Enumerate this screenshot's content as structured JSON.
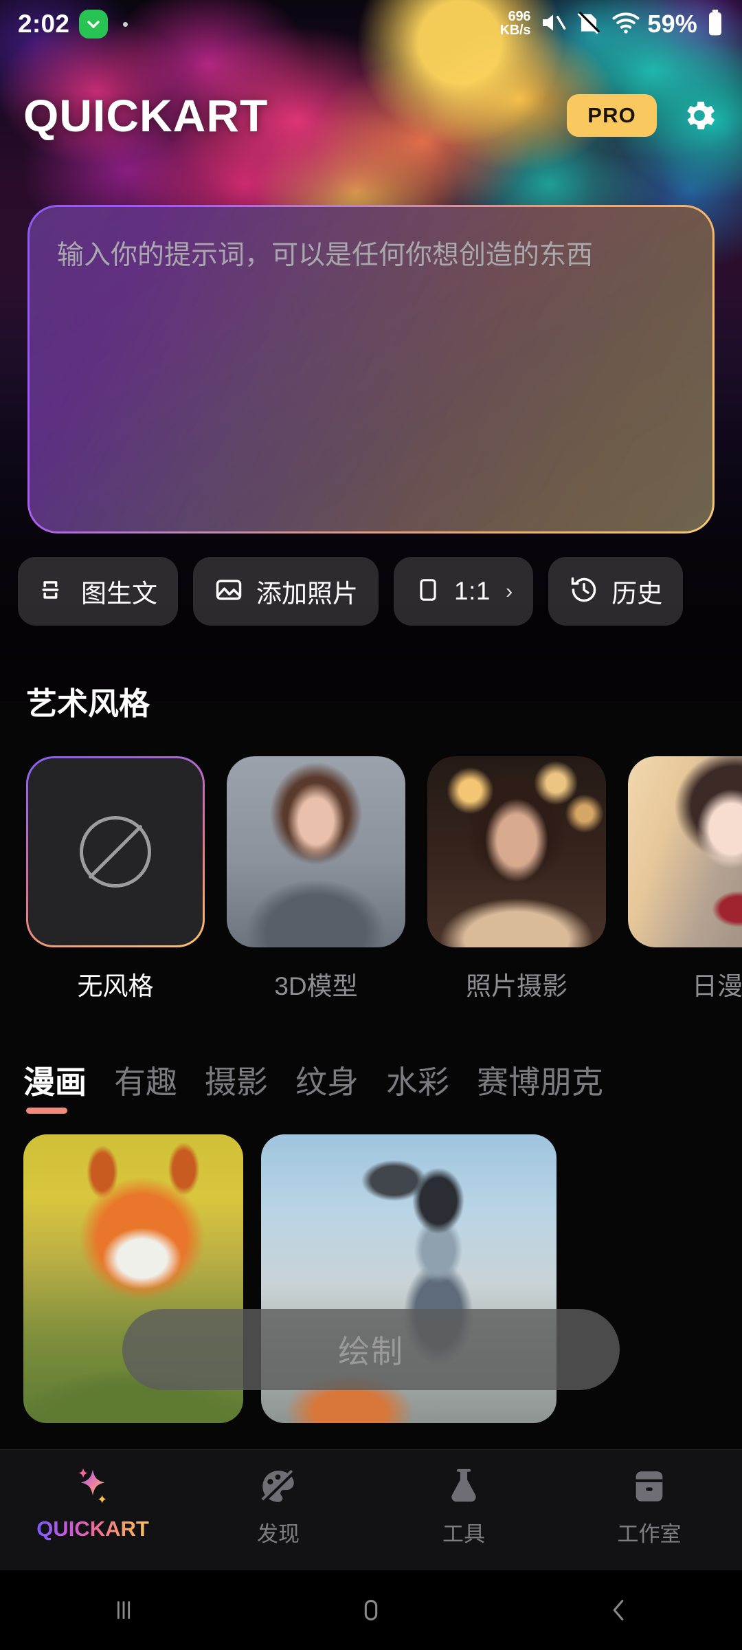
{
  "statusbar": {
    "time": "2:02",
    "badge_icon": "download-chevron-icon",
    "net_speed_value": "696",
    "net_speed_unit": "KB/s",
    "mute_icon": "volume-mute-icon",
    "nosim_icon": "no-sim-icon",
    "wifi_icon": "wifi-icon",
    "battery_percent": "59%",
    "battery_icon": "battery-icon"
  },
  "header": {
    "brand": "QUICKART",
    "pro_label": "PRO",
    "settings_icon": "gear-icon"
  },
  "prompt": {
    "placeholder": "输入你的提示词，可以是任何你想创造的东西",
    "value": "",
    "border_gradient_from": "#8b5cf6",
    "border_gradient_to": "#f7c877"
  },
  "chips": [
    {
      "label": "图生文",
      "icon": "image-to-text-icon"
    },
    {
      "label": "添加照片",
      "icon": "add-photo-icon"
    },
    {
      "label": "1:1",
      "icon": "aspect-ratio-icon",
      "chevron": "›"
    },
    {
      "label": "历史",
      "icon": "history-icon"
    }
  ],
  "styles": {
    "section_title": "艺术风格",
    "items": [
      {
        "label": "无风格",
        "selected": true,
        "thumb": "none"
      },
      {
        "label": "3D模型",
        "selected": false,
        "thumb": "th3d"
      },
      {
        "label": "照片摄影",
        "selected": false,
        "thumb": "thphoto"
      },
      {
        "label": "日漫",
        "selected": false,
        "thumb": "thanime"
      }
    ],
    "selected_border_color": "#f08a7a"
  },
  "tabs": {
    "active_index": 0,
    "underline_color": "#f08a7a",
    "items": [
      {
        "label": "漫画"
      },
      {
        "label": "有趣"
      },
      {
        "label": "摄影"
      },
      {
        "label": "纹身"
      },
      {
        "label": "水彩"
      },
      {
        "label": "赛博朋克"
      }
    ]
  },
  "gallery": [
    {
      "alt": "fox-character-autumn-park"
    },
    {
      "alt": "woman-helmet-frying-pan-street"
    }
  ],
  "draw_button": {
    "label": "绘制",
    "enabled": false
  },
  "bottom_nav": {
    "active_index": 0,
    "items": [
      {
        "label": "QUICKART",
        "icon": "sparkle-icon"
      },
      {
        "label": "发现",
        "icon": "palette-icon"
      },
      {
        "label": "工具",
        "icon": "flask-icon"
      },
      {
        "label": "工作室",
        "icon": "briefcase-icon"
      }
    ]
  },
  "system_nav": {
    "recents_icon": "recents-icon",
    "home_icon": "home-icon",
    "back_icon": "back-icon"
  }
}
